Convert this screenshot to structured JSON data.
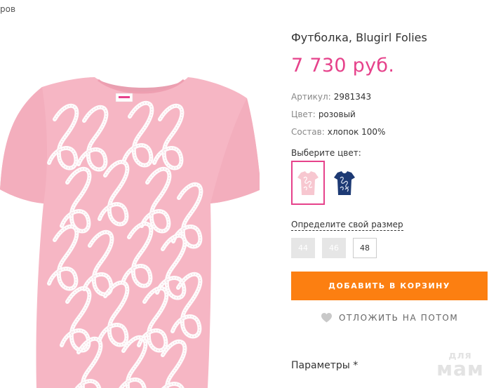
{
  "breadcrumb": {
    "text": "ров"
  },
  "product": {
    "title": "Футболка, Blugirl Folies",
    "price": "7 730 руб.",
    "specs": [
      {
        "label": "Артикул:",
        "value": "2981343"
      },
      {
        "label": "Цвет:",
        "value": "розовый"
      },
      {
        "label": "Состав:",
        "value": "хлопок 100%"
      }
    ]
  },
  "colors": {
    "label": "Выберите цвет:",
    "options": [
      {
        "name": "pink",
        "hex": "#f7c7d0",
        "selected": true
      },
      {
        "name": "navy",
        "hex": "#1d3a74",
        "selected": false
      }
    ]
  },
  "sizes": {
    "link": "Определите свой размер",
    "options": [
      {
        "label": "44",
        "available": false
      },
      {
        "label": "46",
        "available": false
      },
      {
        "label": "48",
        "available": true
      }
    ]
  },
  "actions": {
    "add_to_cart": "ДОБАВИТЬ В КОРЗИНУ",
    "save_for_later": "ОТЛОЖИТЬ НА ПОТОМ"
  },
  "parameters": {
    "heading": "Параметры *"
  },
  "watermark": {
    "line1": "для",
    "line2": "мам"
  },
  "colors_theme": {
    "accent_pink": "#e6428b",
    "button_orange": "#fc7f11"
  }
}
